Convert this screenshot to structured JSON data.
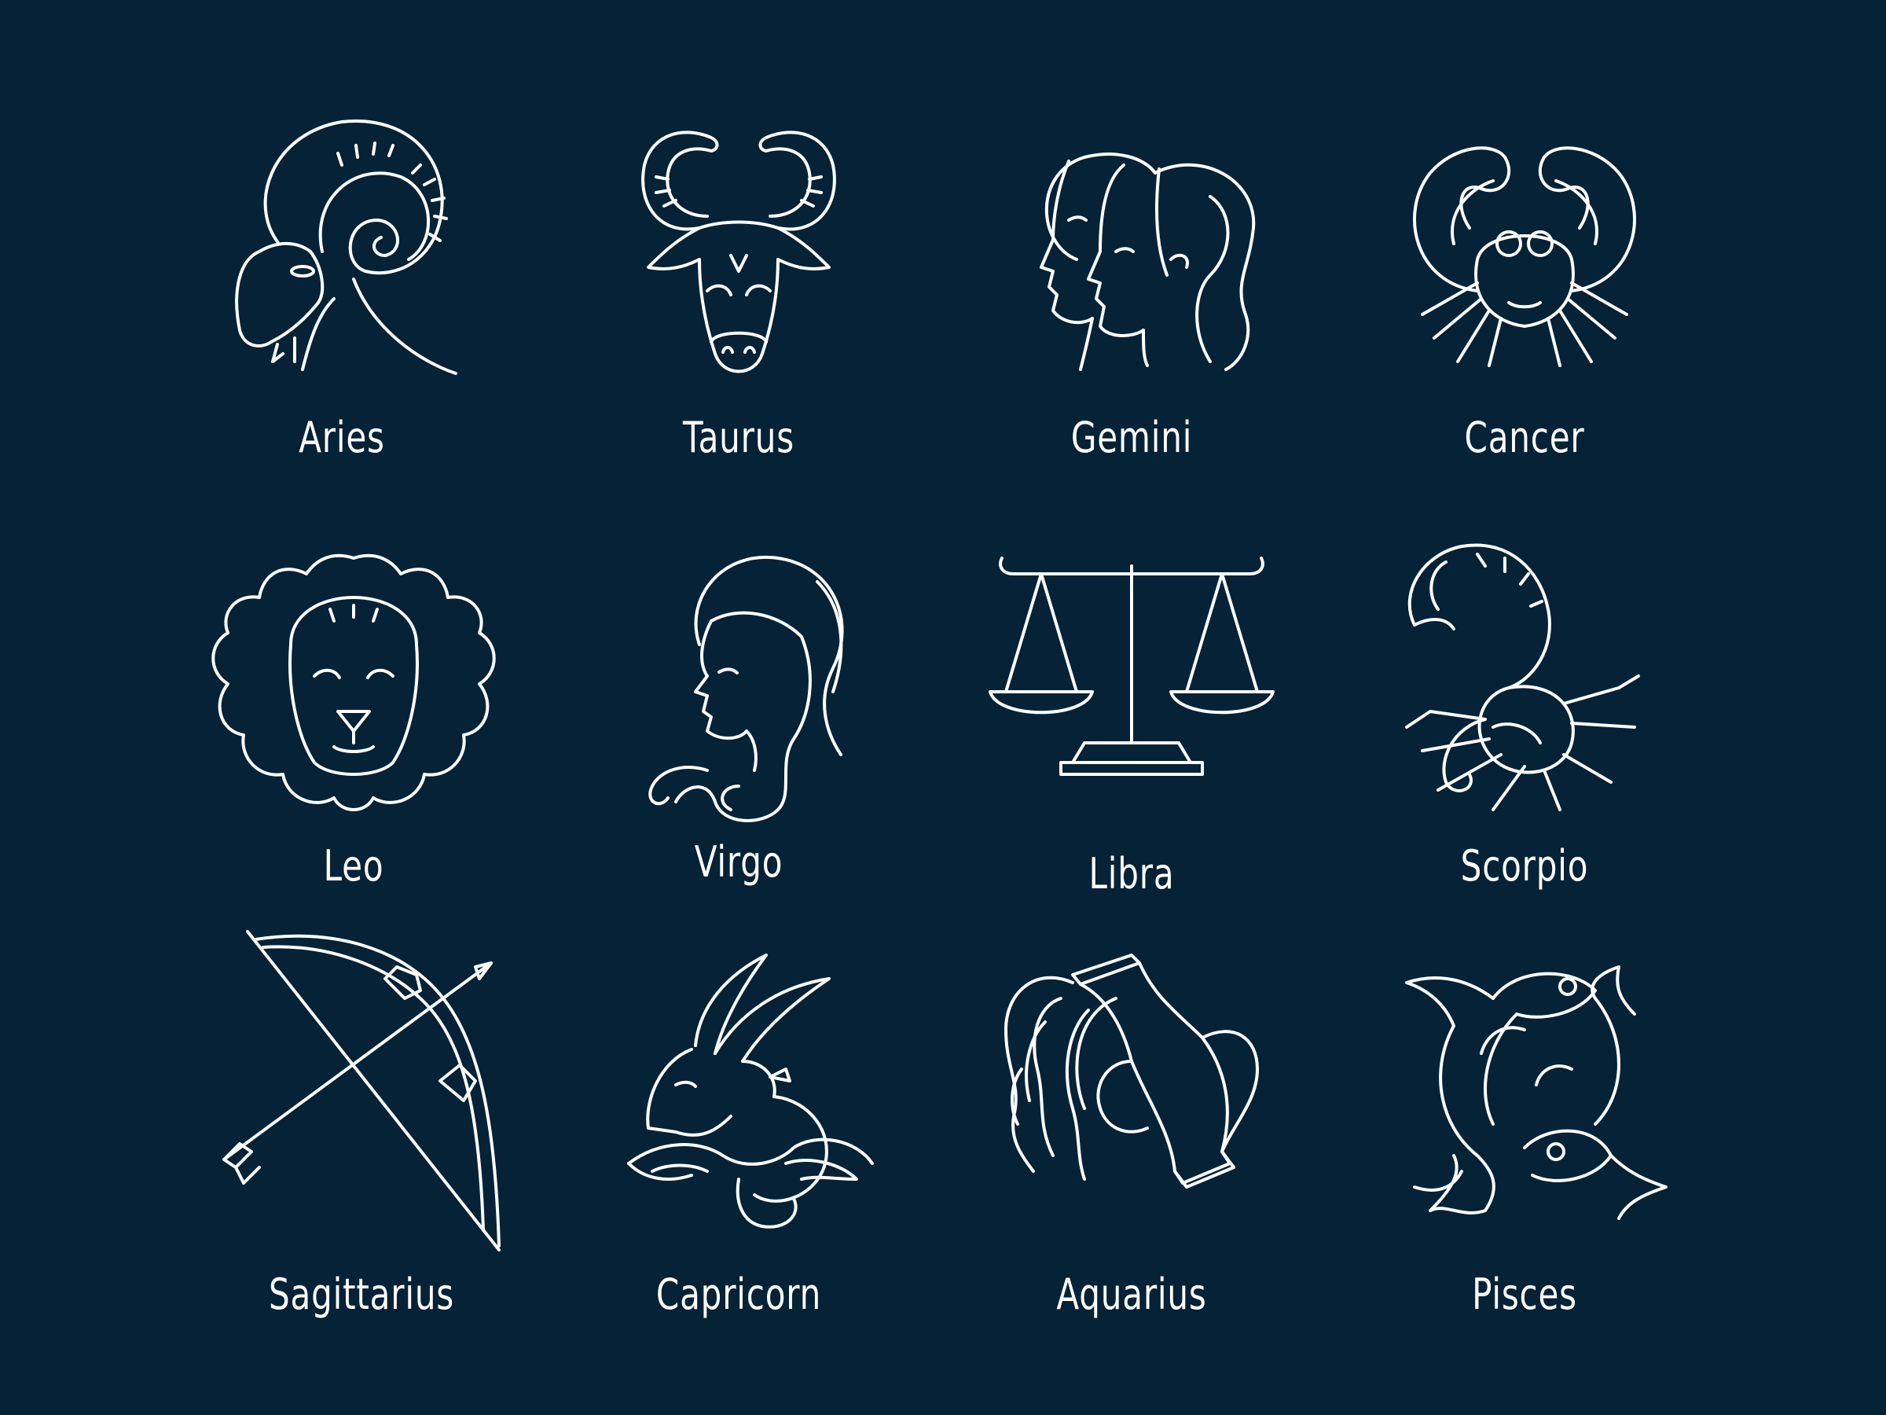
{
  "background_color": "#062237",
  "line_color": "#ffffff",
  "signs": [
    {
      "name": "Aries",
      "icon": "ram-icon"
    },
    {
      "name": "Taurus",
      "icon": "bull-icon"
    },
    {
      "name": "Gemini",
      "icon": "twins-icon"
    },
    {
      "name": "Cancer",
      "icon": "crab-icon"
    },
    {
      "name": "Leo",
      "icon": "lion-icon"
    },
    {
      "name": "Virgo",
      "icon": "maiden-icon"
    },
    {
      "name": "Libra",
      "icon": "scales-icon"
    },
    {
      "name": "Scorpio",
      "icon": "scorpion-icon"
    },
    {
      "name": "Sagittarius",
      "icon": "bow-and-arrow-icon"
    },
    {
      "name": "Capricorn",
      "icon": "sea-goat-icon"
    },
    {
      "name": "Aquarius",
      "icon": "water-jar-icon"
    },
    {
      "name": "Pisces",
      "icon": "fish-icon"
    }
  ]
}
